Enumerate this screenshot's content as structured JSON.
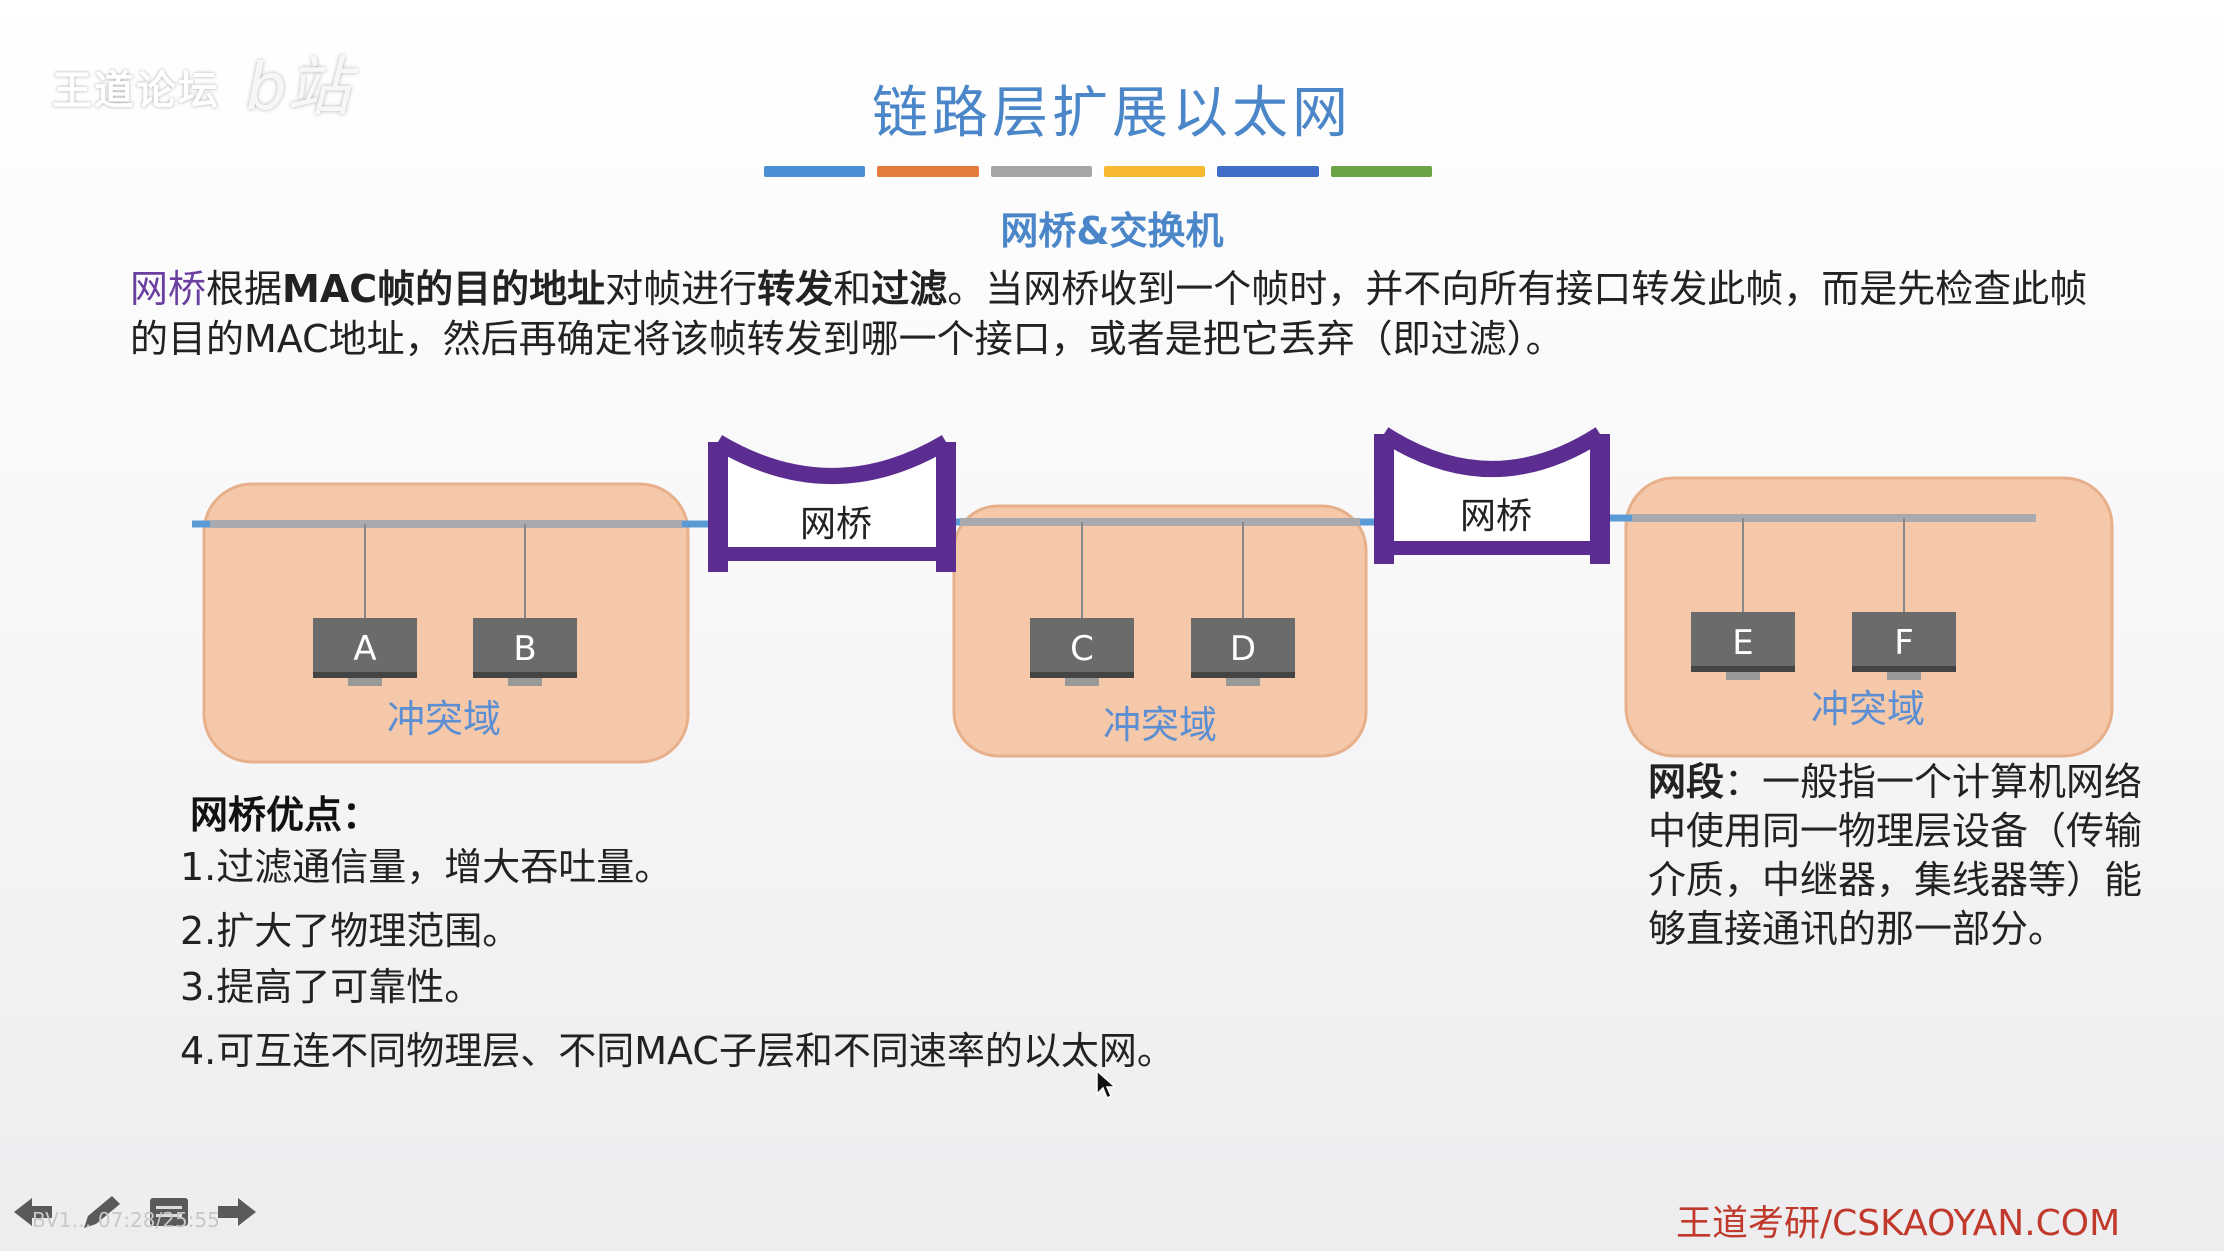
{
  "logo": {
    "text": "王道论坛",
    "sub": "b站"
  },
  "title": "链路层扩展以太网",
  "color_bars": [
    "#4a8fd4",
    "#e37b3c",
    "#a5a5a5",
    "#f6b82f",
    "#3f6dc7",
    "#6aa444"
  ],
  "subtitle": "网桥&交换机",
  "intro": {
    "p1": "网桥",
    "p2": "根据",
    "p3": "MAC帧的目的地址",
    "p4": "对帧进行",
    "p5": "转发",
    "p6": "和",
    "p7": "过滤",
    "p8": "。当网桥收到一个帧时，并不向所有接口转发此帧，而是先检查此帧的目的MAC地址，然后再确定将该帧转发到哪一个接口，或者是把它丢弃（即过滤）。"
  },
  "diagram": {
    "bridges": [
      "网桥",
      "网桥"
    ],
    "domains": [
      "冲突域",
      "冲突域",
      "冲突域"
    ],
    "hosts": [
      "A",
      "B",
      "C",
      "D",
      "E",
      "F"
    ]
  },
  "advantages": {
    "title": "网桥优点：",
    "items": [
      "1.过滤通信量，增大吞吐量。",
      "2.扩大了物理范围。",
      "3.提高了可靠性。",
      "4.可互连不同物理层、不同MAC子层和不同速率的以太网。"
    ]
  },
  "segment": {
    "term": "网段",
    "definition": "：一般指一个计算机网络中使用同一物理层设备（传输介质，中继器，集线器等）能够直接通讯的那一部分。"
  },
  "footer": "王道考研/CSKAOYAN.COM",
  "player": {
    "info": "BV1… 07:28/25:55"
  },
  "icons": [
    "back-arrow-icon",
    "pen-icon",
    "menu-icon",
    "forward-arrow-icon"
  ],
  "colors": {
    "title": "#4a86c8",
    "bridge": "#5b2d91",
    "domain_fill": "#f4c8a8",
    "footer": "#c0392b"
  }
}
